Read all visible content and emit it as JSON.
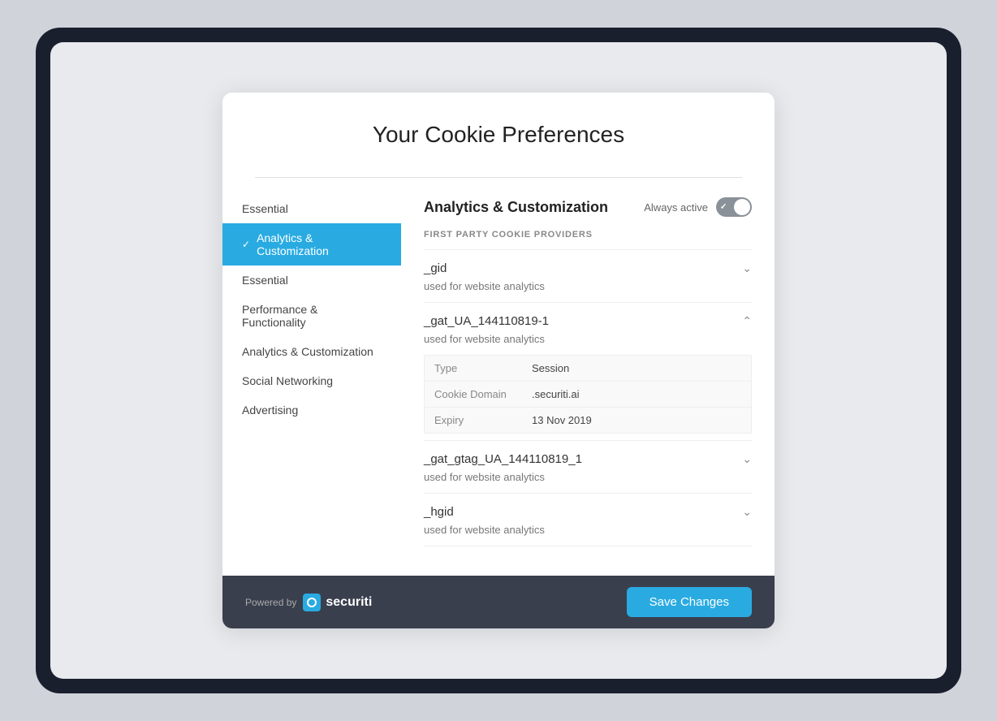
{
  "modal": {
    "title": "Your Cookie Preferences",
    "divider": true
  },
  "sidebar": {
    "items": [
      {
        "id": "essential-top",
        "label": "Essential",
        "active": false
      },
      {
        "id": "analytics-customization-active",
        "label": "Analytics & Customization",
        "active": true
      },
      {
        "id": "essential",
        "label": "Essential",
        "active": false
      },
      {
        "id": "performance-functionality",
        "label": "Performance & Functionality",
        "active": false
      },
      {
        "id": "analytics-customization",
        "label": "Analytics & Customization",
        "active": false
      },
      {
        "id": "social-networking",
        "label": "Social Networking",
        "active": false
      },
      {
        "id": "advertising",
        "label": "Advertising",
        "active": false
      }
    ]
  },
  "detail": {
    "title": "Analytics & Customization",
    "always_active_label": "Always active",
    "section_label": "FIRST PARTY COOKIE PROVIDERS",
    "cookies": [
      {
        "name": "_gid",
        "description": "used for website analytics",
        "expanded": false,
        "details": []
      },
      {
        "name": "_gat_UA_144110819-1",
        "description": "used for website analytics",
        "expanded": true,
        "details": [
          {
            "key": "Type",
            "value": "Session"
          },
          {
            "key": "Cookie Domain",
            "value": ".securiti.ai"
          },
          {
            "key": "Expiry",
            "value": "13 Nov 2019"
          }
        ]
      },
      {
        "name": "_gat_gtag_UA_144110819_1",
        "description": "used for website analytics",
        "expanded": false,
        "details": []
      },
      {
        "name": "_hgid",
        "description": "used for website analytics",
        "expanded": false,
        "details": []
      }
    ]
  },
  "footer": {
    "powered_by_text": "Powered by",
    "logo_name": "securiti",
    "save_button_label": "Save Changes"
  }
}
